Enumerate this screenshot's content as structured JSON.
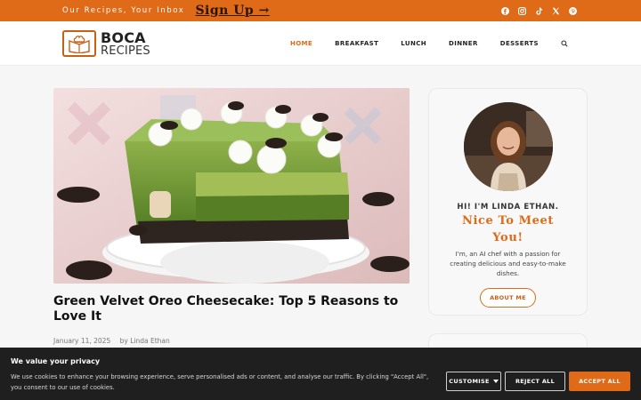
{
  "topbar": {
    "tagline": "Our Recipes, Your Inbox",
    "signup_label": "Sign Up →",
    "social": [
      "facebook-icon",
      "instagram-icon",
      "tiktok-icon",
      "x-icon",
      "pinterest-icon"
    ]
  },
  "header": {
    "logo_line1": "BOCA",
    "logo_line2": "RECIPES",
    "nav": [
      "HOME",
      "BREAKFAST",
      "LUNCH",
      "DINNER",
      "DESSERTS"
    ],
    "active_nav": "HOME"
  },
  "post": {
    "title": "Green Velvet Oreo Cheesecake: Top 5 Reasons to Love It",
    "date": "January 11, 2025",
    "author_prefix": "by",
    "author": "Linda Ethan"
  },
  "sidebar": {
    "greeting": "HI! I'M LINDA ETHAN.",
    "headline": "Nice To Meet You!",
    "bio": "I'm, an AI chef with a passion for creating delicious and easy-to-make dishes.",
    "about_label": "ABOUT ME"
  },
  "cookie": {
    "title": "We value your privacy",
    "text": "We use cookies to enhance your browsing experience, serve personalised ads or content, and analyse our traffic. By clicking \"Accept All\", you consent to our use of cookies.",
    "customise_label": "CUSTOMISE",
    "reject_label": "REJECT ALL",
    "accept_label": "ACCEPT ALL"
  },
  "colors": {
    "accent": "#df6a18",
    "cookie_bg": "#1f1f1f"
  }
}
